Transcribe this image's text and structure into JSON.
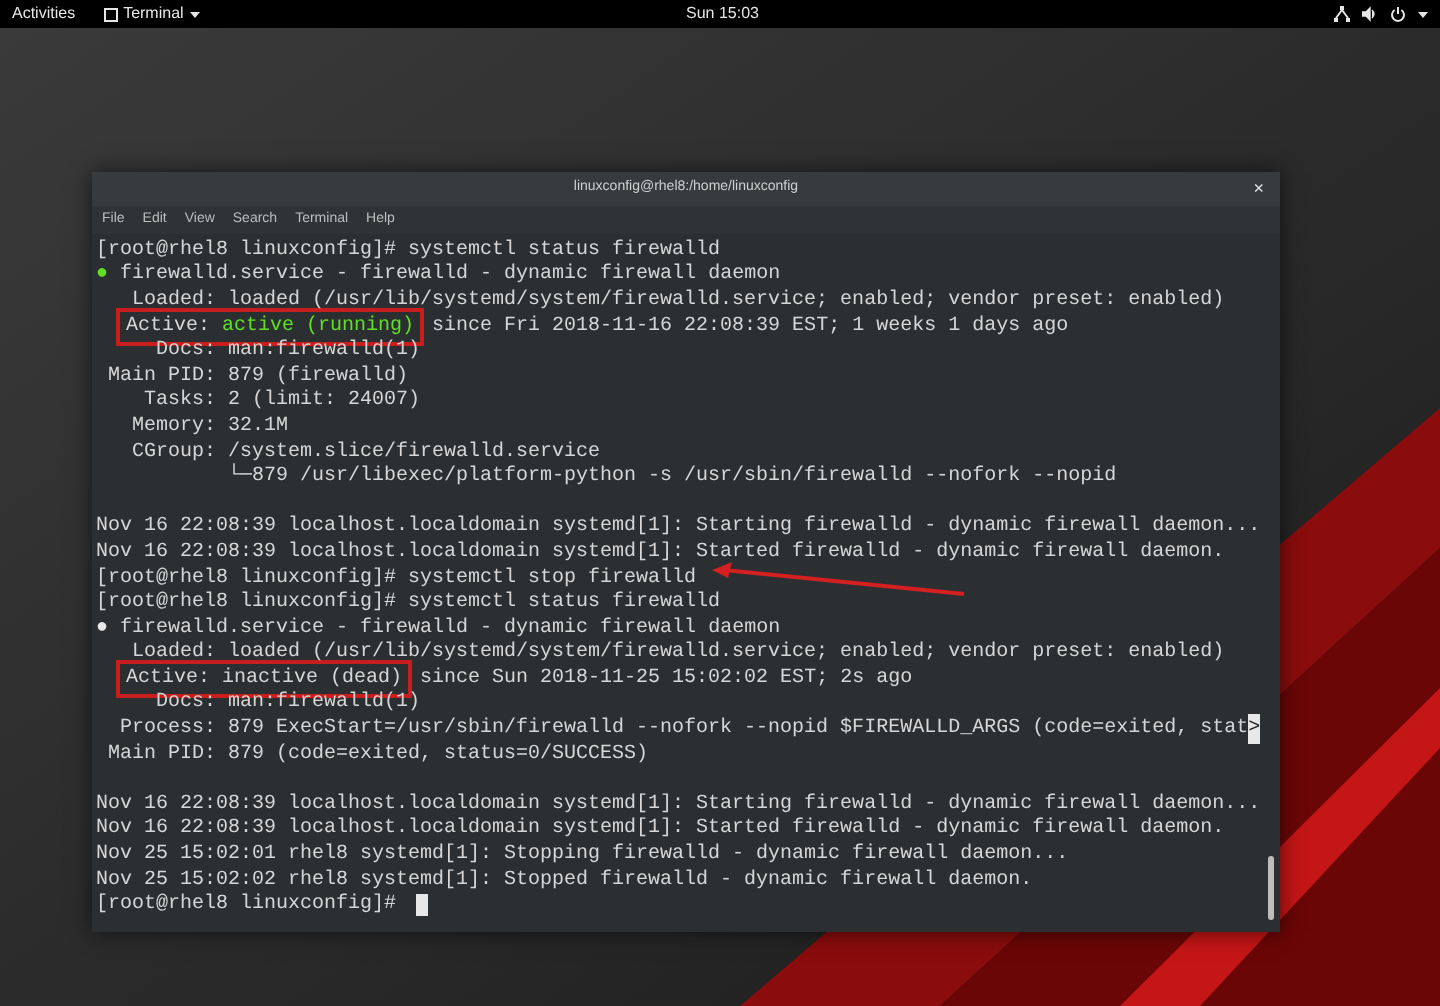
{
  "top_bar": {
    "activities": "Activities",
    "app_menu": "Terminal",
    "clock": "Sun 15:03"
  },
  "window": {
    "title": "linuxconfig@rhel8:/home/linuxconfig",
    "close": "×",
    "menu": [
      "File",
      "Edit",
      "View",
      "Search",
      "Terminal",
      "Help"
    ]
  },
  "terminal": {
    "lines": [
      {
        "kind": "text",
        "text": "[root@rhel8 linuxconfig]# systemctl status firewalld"
      },
      {
        "kind": "unit",
        "dot": "●",
        "running": true,
        "text": "firewalld.service - firewalld - dynamic firewall daemon"
      },
      {
        "kind": "text",
        "text": "   Loaded: loaded (/usr/lib/systemd/system/firewalld.service; enabled; vendor preset: enabled)"
      },
      {
        "kind": "active",
        "label": "Active:",
        "state": "active (running)",
        "rest": "since Fri 2018-11-16 22:08:39 EST; 1 weeks 1 days ago",
        "running": true,
        "boxed": true
      },
      {
        "kind": "text",
        "text": "     Docs: man:firewalld(1)"
      },
      {
        "kind": "text",
        "text": " Main PID: 879 (firewalld)"
      },
      {
        "kind": "text",
        "text": "    Tasks: 2 (limit: 24007)"
      },
      {
        "kind": "text",
        "text": "   Memory: 32.1M"
      },
      {
        "kind": "text",
        "text": "   CGroup: /system.slice/firewalld.service"
      },
      {
        "kind": "text",
        "text": "           └─879 /usr/libexec/platform-python -s /usr/sbin/firewalld --nofork --nopid"
      },
      {
        "kind": "blank"
      },
      {
        "kind": "text",
        "text": "Nov 16 22:08:39 localhost.localdomain systemd[1]: Starting firewalld - dynamic firewall daemon..."
      },
      {
        "kind": "text",
        "text": "Nov 16 22:08:39 localhost.localdomain systemd[1]: Started firewalld - dynamic firewall daemon."
      },
      {
        "kind": "text",
        "text": "[root@rhel8 linuxconfig]# systemctl stop firewalld",
        "arrow": true
      },
      {
        "kind": "text",
        "text": "[root@rhel8 linuxconfig]# systemctl status firewalld"
      },
      {
        "kind": "unit",
        "dot": "●",
        "running": false,
        "text": "firewalld.service - firewalld - dynamic firewall daemon"
      },
      {
        "kind": "text",
        "text": "   Loaded: loaded (/usr/lib/systemd/system/firewalld.service; enabled; vendor preset: enabled)"
      },
      {
        "kind": "active",
        "label": "Active:",
        "state": "inactive (dead)",
        "rest": "since Sun 2018-11-25 15:02:02 EST; 2s ago",
        "running": false,
        "boxed": true
      },
      {
        "kind": "text",
        "text": "     Docs: man:firewalld(1)"
      },
      {
        "kind": "text",
        "text": "  Process: 879 ExecStart=/usr/sbin/firewalld --nofork --nopid $FIREWALLD_ARGS (code=exited, stat",
        "marker": ">"
      },
      {
        "kind": "text",
        "text": " Main PID: 879 (code=exited, status=0/SUCCESS)"
      },
      {
        "kind": "blank"
      },
      {
        "kind": "text",
        "text": "Nov 16 22:08:39 localhost.localdomain systemd[1]: Starting firewalld - dynamic firewall daemon..."
      },
      {
        "kind": "text",
        "text": "Nov 16 22:08:39 localhost.localdomain systemd[1]: Started firewalld - dynamic firewall daemon."
      },
      {
        "kind": "text",
        "text": "Nov 25 15:02:01 rhel8 systemd[1]: Stopping firewalld - dynamic firewall daemon..."
      },
      {
        "kind": "text",
        "text": "Nov 25 15:02:02 rhel8 systemd[1]: Stopped firewalld - dynamic firewall daemon."
      },
      {
        "kind": "prompt",
        "text": "[root@rhel8 linuxconfig]#",
        "cursor": true
      }
    ]
  }
}
